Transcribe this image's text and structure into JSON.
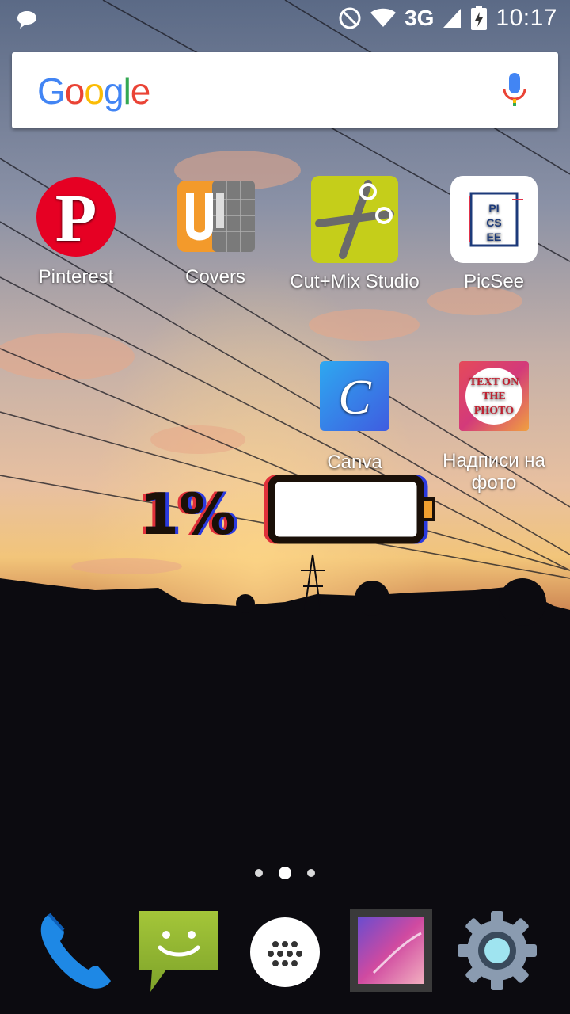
{
  "status_bar": {
    "time": "10:17",
    "network": "3G",
    "icons": [
      "chat-bubble-icon",
      "do-not-disturb-icon",
      "wifi-icon",
      "signal-icon",
      "battery-charging-icon"
    ]
  },
  "search": {
    "logo": "Google",
    "icon": "mic-icon"
  },
  "apps": [
    {
      "label": "Pinterest",
      "icon": "pinterest-icon"
    },
    {
      "label": "Covers",
      "icon": "covers-icon"
    },
    {
      "label": "Cut+Mix Studio",
      "icon": "scissors-icon"
    },
    {
      "label": "PicSee",
      "icon": "picsee-icon"
    },
    {
      "label": "Canva",
      "icon": "canva-icon"
    },
    {
      "label": "Надписи на фото",
      "icon": "text-on-photo-icon"
    }
  ],
  "widget": {
    "battery_level": "1%"
  },
  "app_icon_text": {
    "picsee": [
      "PI",
      "CS",
      "EE"
    ],
    "canva": "C",
    "text_on_photo": [
      "TEXT ON",
      "THE",
      "PHOTO"
    ]
  },
  "page_indicator": {
    "pages": 3,
    "active": 1
  },
  "dock": [
    {
      "icon": "phone-icon"
    },
    {
      "icon": "messaging-icon"
    },
    {
      "icon": "app-drawer-icon"
    },
    {
      "icon": "gallery-icon"
    },
    {
      "icon": "settings-icon"
    }
  ],
  "colors": {
    "google_blue": "#4285F4",
    "google_red": "#EA4335",
    "google_yellow": "#FBBC05",
    "google_green": "#34A853",
    "pinterest_red": "#E60023",
    "cutmix_green": "#C5CE1A",
    "canva_blue": "#3B8FE8"
  }
}
